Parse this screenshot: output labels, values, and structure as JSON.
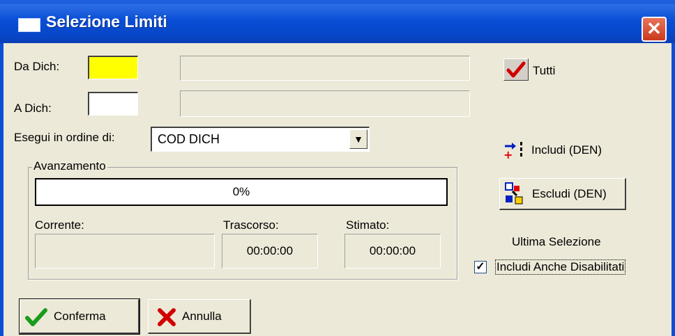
{
  "window": {
    "title": "Selezione Limiti",
    "close_glyph": "✕"
  },
  "form": {
    "da_dich_label": "Da Dich:",
    "a_dich_label": "A  Dich:",
    "order_label": "Esegui in ordine di:",
    "order_value": "COD DICH",
    "dropdown_glyph": "▼"
  },
  "progress_group": {
    "title": "Avanzamento",
    "progress_text": "0%",
    "progress_value": 0,
    "corrente_label": "Corrente:",
    "trascorso_label": "Trascorso:",
    "stimato_label": "Stimato:",
    "trascorso_value": "00:00:00",
    "stimato_value": "00:00:00"
  },
  "side": {
    "tutti_label": "Tutti",
    "includi_label": "Includi (DEN)",
    "escludi_label": "Escludi (DEN)",
    "ultima_label": "Ultima Selezione",
    "disabilitati_label": "Includi Anche Disabilitati",
    "disabilitati_checked": true,
    "check_glyph": "✓"
  },
  "footer": {
    "conferma_label": "Conferma",
    "annulla_label": "Annulla"
  },
  "colors": {
    "titlebar": "#0746c8",
    "highlight_field": "#ffff00",
    "face": "#ece9d8"
  }
}
